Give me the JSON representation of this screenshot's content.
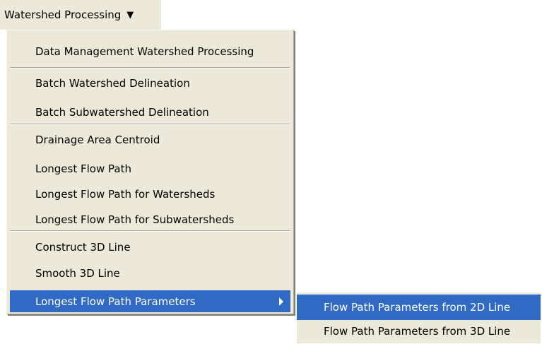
{
  "menubar": {
    "label": "Watershed Processing",
    "arrow_icon": "triangle-down"
  },
  "menu": {
    "items": [
      {
        "label": "Data Management Watershed Processing"
      },
      {
        "label": "Batch Watershed Delineation"
      },
      {
        "label": "Batch Subwatershed Delineation"
      },
      {
        "label": "Drainage Area Centroid"
      },
      {
        "label": "Longest Flow Path"
      },
      {
        "label": "Longest Flow Path for Watersheds"
      },
      {
        "label": "Longest Flow Path for Subwatersheds"
      },
      {
        "label": "Construct 3D Line"
      },
      {
        "label": "Smooth 3D Line"
      },
      {
        "label": "Longest Flow Path Parameters"
      }
    ]
  },
  "submenu": {
    "items": [
      {
        "label": "Flow Path Parameters from 2D Line"
      },
      {
        "label": "Flow Path Parameters from 3D Line"
      }
    ]
  },
  "colors": {
    "menu_bg": "#ece9d8",
    "highlight": "#316ac5",
    "separator": "#aca899"
  }
}
